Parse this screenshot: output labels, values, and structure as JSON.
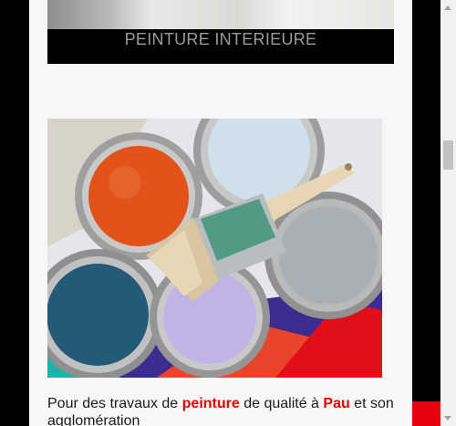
{
  "top_section": {
    "caption": "PEINTURE INTERIEURE"
  },
  "intro": {
    "part1": "Pour des travaux de ",
    "highlight1": "peinture",
    "part2": " de qualité à ",
    "highlight2": "Pau",
    "part3": " et son agglomération"
  },
  "colors": {
    "highlight": "#e00000",
    "background": "#f7f7f7",
    "frame": "#000000"
  }
}
